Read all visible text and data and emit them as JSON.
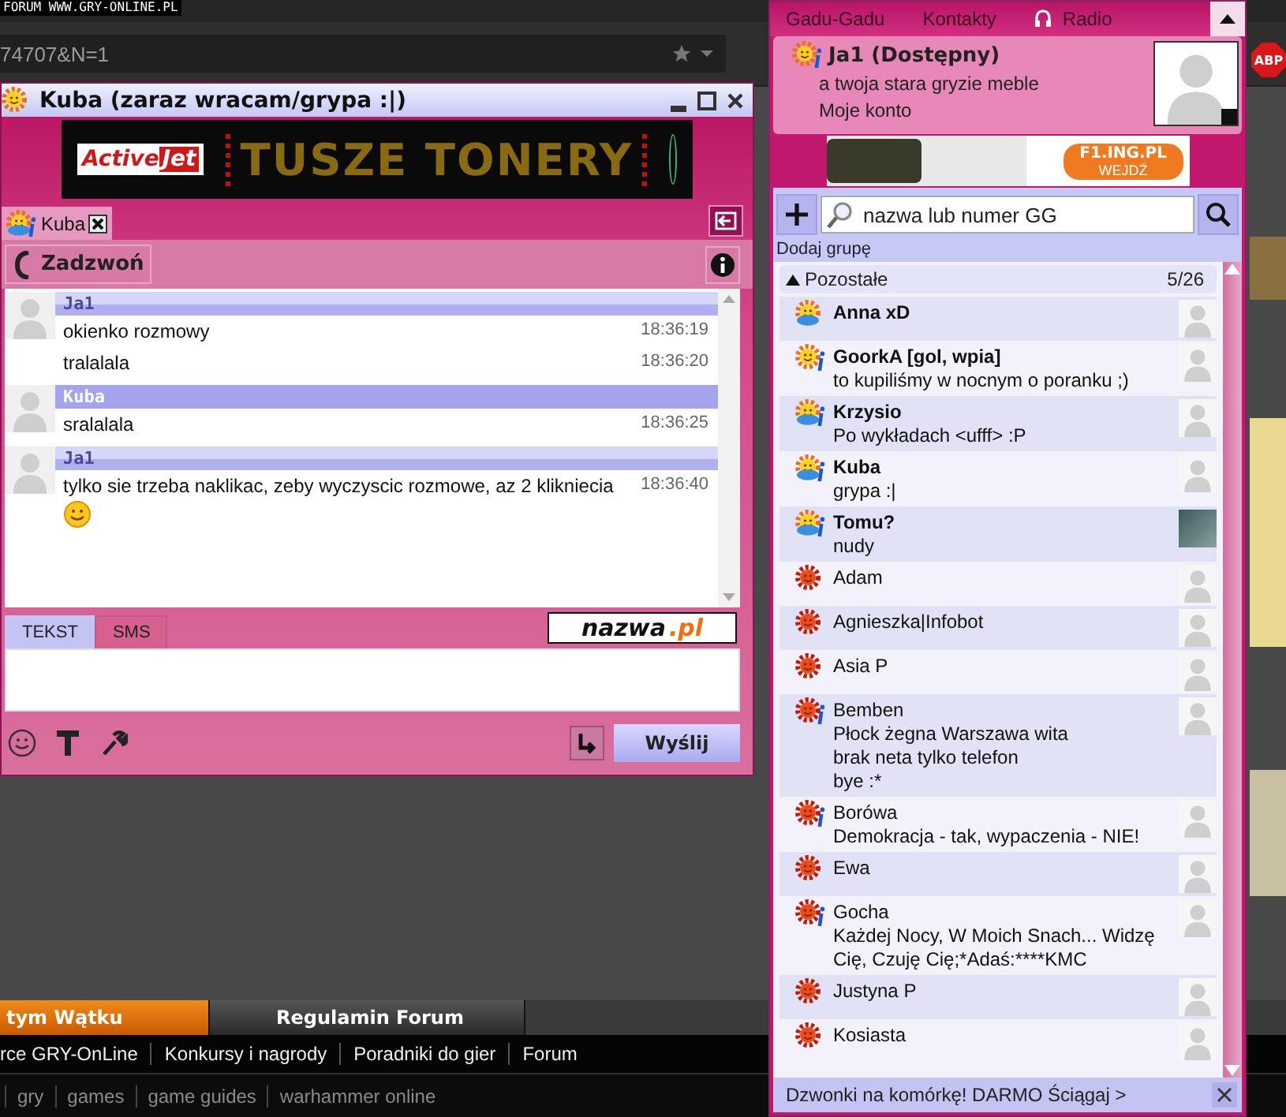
{
  "page": {
    "site_label": "FORUM WWW.GRY-ONLINE.PL",
    "address": "74707&N=1",
    "badge": "ABP",
    "nav_tabs": [
      {
        "label": "tym Wątku",
        "selected": true
      },
      {
        "label": "Regulamin Forum",
        "selected": false
      }
    ],
    "footer_links": [
      "rce GRY-OnLine",
      "Konkursy i nagrody",
      "Poradniki do gier",
      "Forum"
    ],
    "tag_links": [
      "gry",
      "games",
      "game guides",
      "warhammer online"
    ]
  },
  "chat_window": {
    "title": "Kuba (zaraz wracam/grypa :|)",
    "title_icon": {
      "kind": "available"
    },
    "banner": {
      "brand_left": "Active",
      "brand_right": "Jet",
      "headline": "TUSZE TONERY"
    },
    "tabs": [
      {
        "label": "Kuba",
        "kind": "busy",
        "selected": true
      }
    ],
    "call_button": "Zadzwoń",
    "messages": [
      {
        "sender": "Ja1",
        "kind": "self",
        "lines": [
          {
            "text": "okienko rozmowy",
            "time": "18:36:19",
            "emoticon": false
          },
          {
            "text": "tralalala",
            "time": "18:36:20",
            "emoticon": false
          }
        ]
      },
      {
        "sender": "Kuba",
        "kind": "other",
        "lines": [
          {
            "text": "sralalala",
            "time": "18:36:25",
            "emoticon": false
          }
        ]
      },
      {
        "sender": "Ja1",
        "kind": "self",
        "lines": [
          {
            "text": "tylko sie trzeba naklikac, zeby wyczyscic rozmowe, az 2 klikniecia",
            "time": "18:36:40",
            "emoticon": true
          }
        ]
      }
    ],
    "input_tabs": [
      {
        "label": "TEKST",
        "selected": true
      },
      {
        "label": "SMS",
        "selected": false
      }
    ],
    "ad": {
      "name": "nazwa",
      "tld": ".pl"
    },
    "send_button": "Wyślij"
  },
  "contacts_window": {
    "menu": [
      {
        "label": "Gadu-Gadu",
        "kind": "text"
      },
      {
        "label": "Kontakty",
        "kind": "text"
      },
      {
        "label": "Radio",
        "kind": "radio"
      }
    ],
    "profile": {
      "name": "Ja1 (Dostępny)",
      "kind": "available",
      "description": "a twoja stara gryzie meble",
      "account_link": "Moje konto"
    },
    "ad": {
      "headline": "F1.ING.PL",
      "action": "WEJDŹ"
    },
    "search": {
      "placeholder": "nazwa lub numer GG"
    },
    "add_group": "Dodaj grupę",
    "group": {
      "name": "Pozostałe",
      "count": "5/26",
      "expanded": true
    },
    "contacts": [
      {
        "name": "Anna xD",
        "kind": "busy",
        "info": false,
        "photo": false
      },
      {
        "name": "GoorkA [gol, wpia]",
        "kind": "available",
        "info": true,
        "lines": [
          "to kupiliśmy w nocnym o poranku ;)"
        ],
        "photo": false
      },
      {
        "name": "Krzysio",
        "kind": "busy",
        "info": true,
        "lines": [
          "Po wykładach <ufff> :P"
        ],
        "photo": false
      },
      {
        "name": "Kuba",
        "kind": "busy",
        "info": true,
        "lines": [
          "grypa :|"
        ],
        "photo": false
      },
      {
        "name": "Tomu?",
        "kind": "busy",
        "info": true,
        "lines": [
          "nudy"
        ],
        "photo": true
      },
      {
        "name": "Adam",
        "kind": "offline",
        "info": false,
        "photo": false
      },
      {
        "name": "Agnieszka|Infobot",
        "kind": "offline",
        "info": false,
        "photo": false
      },
      {
        "name": "Asia P",
        "kind": "offline",
        "info": false,
        "photo": false
      },
      {
        "name": "Bemben",
        "kind": "offline",
        "info": true,
        "lines": [
          "Płock żegna Warszawa wita",
          "brak neta tylko telefon",
          "bye :*"
        ],
        "photo": false
      },
      {
        "name": "Borówa",
        "kind": "offline",
        "info": true,
        "lines": [
          "Demokracja - tak, wypaczenia - NIE!"
        ],
        "photo": false
      },
      {
        "name": "Ewa",
        "kind": "offline",
        "info": false,
        "photo": false
      },
      {
        "name": "Gocha",
        "kind": "offline",
        "info": true,
        "lines": [
          "Każdej Nocy, W Moich Snach... Widzę",
          "Cię, Czuję Cię;*Adaś:****KMC"
        ],
        "photo": false
      },
      {
        "name": "Justyna P",
        "kind": "offline",
        "info": false,
        "photo": false
      },
      {
        "name": "Kosiasta",
        "kind": "offline",
        "info": false,
        "photo": false
      }
    ],
    "footer": "Dzwonki na komórkę! DARMO Ściągaj >"
  }
}
